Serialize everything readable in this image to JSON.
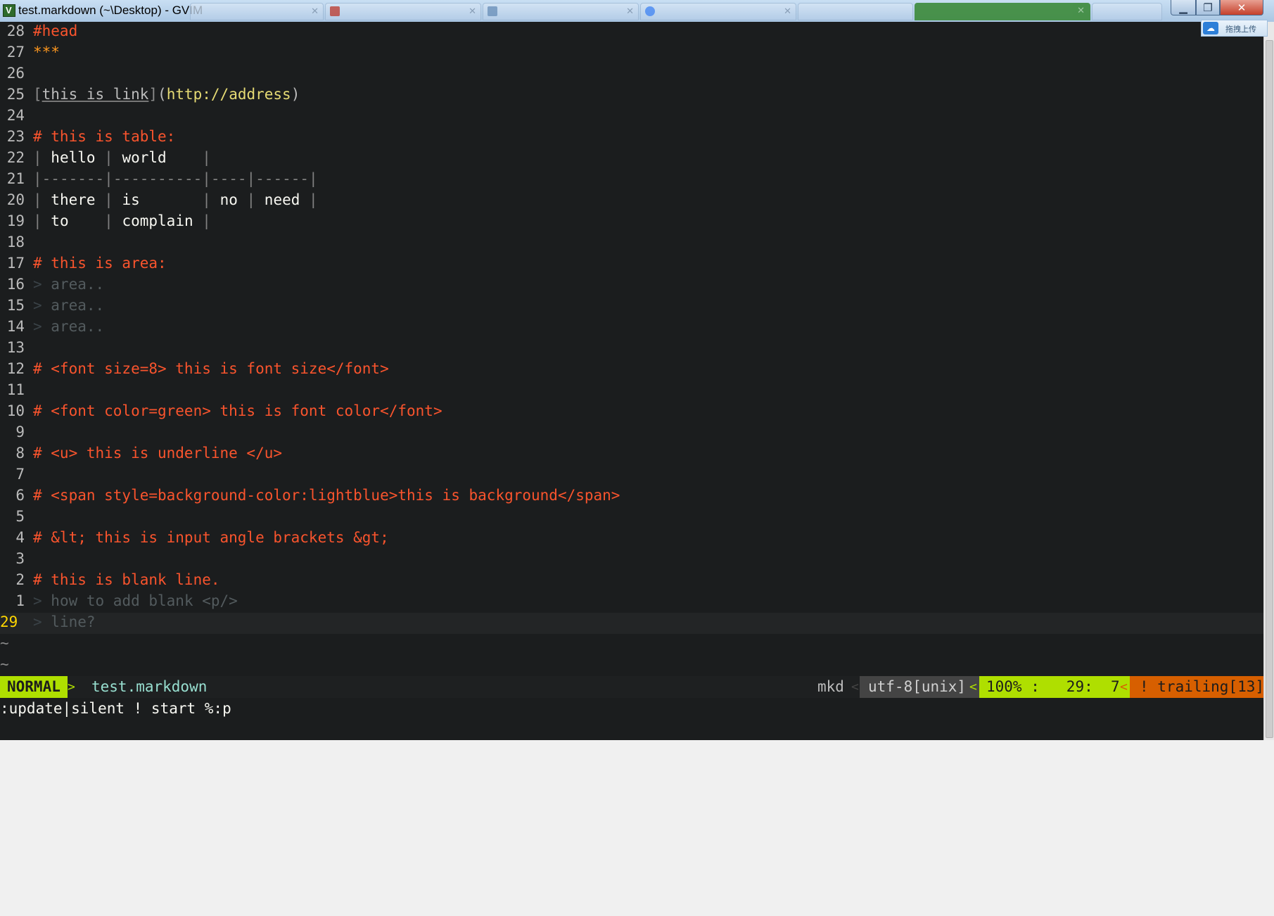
{
  "window": {
    "title": "test.markdown (~\\Desktop) - GVIM",
    "controls": {
      "minimize": "▁",
      "maximize": "❐",
      "close": "✕"
    }
  },
  "upload_widget": {
    "label": "拖拽上传"
  },
  "editor": {
    "lines": [
      {
        "nr": "28",
        "text": "#head",
        "kind": "head"
      },
      {
        "nr": "27",
        "text": "***",
        "kind": "hr"
      },
      {
        "nr": "26",
        "text": "",
        "kind": "plain"
      },
      {
        "nr": "25",
        "link_text": "this is link",
        "link_url": "http://address",
        "kind": "link"
      },
      {
        "nr": "24",
        "text": "",
        "kind": "plain"
      },
      {
        "nr": "23",
        "text": "# this is table:",
        "kind": "head"
      },
      {
        "nr": "22",
        "text": "| hello | world    |",
        "kind": "table"
      },
      {
        "nr": "21",
        "text": "|-------|----------|----|------|",
        "kind": "table-sep"
      },
      {
        "nr": "20",
        "text": "| there | is       | no | need |",
        "kind": "table"
      },
      {
        "nr": "19",
        "text": "| to    | complain |",
        "kind": "table"
      },
      {
        "nr": "18",
        "text": "",
        "kind": "plain"
      },
      {
        "nr": "17",
        "text": "# this is area:",
        "kind": "head"
      },
      {
        "nr": "16",
        "text": "area..",
        "kind": "quote"
      },
      {
        "nr": "15",
        "text": "area..",
        "kind": "quote"
      },
      {
        "nr": "14",
        "text": "area..",
        "kind": "quote"
      },
      {
        "nr": "13",
        "text": "",
        "kind": "plain"
      },
      {
        "nr": "12",
        "text": "# <font size=8> this is font size</font>",
        "kind": "head"
      },
      {
        "nr": "11",
        "text": "",
        "kind": "plain"
      },
      {
        "nr": "10",
        "text": "# <font color=green> this is font color</font>",
        "kind": "head"
      },
      {
        "nr": "9",
        "text": "",
        "kind": "plain"
      },
      {
        "nr": "8",
        "text": "# <u> this is underline </u>",
        "kind": "head"
      },
      {
        "nr": "7",
        "text": "",
        "kind": "plain"
      },
      {
        "nr": "6",
        "text": "# <span style=background-color:lightblue>this is background</span>",
        "kind": "head"
      },
      {
        "nr": "5",
        "text": "",
        "kind": "plain"
      },
      {
        "nr": "4",
        "text": "# &lt; this is input angle brackets &gt;",
        "kind": "head"
      },
      {
        "nr": "3",
        "text": "",
        "kind": "plain"
      },
      {
        "nr": "2",
        "text": "# this is blank line.",
        "kind": "head"
      },
      {
        "nr": "1",
        "text": "how to add blank <p/>",
        "kind": "quote"
      },
      {
        "nr": "29",
        "text": "line?",
        "kind": "quote",
        "current": true
      }
    ],
    "tildes": [
      "~",
      "~"
    ],
    "colors": {
      "background": "#1b1d1e",
      "heading": "#f9542d",
      "line_number": "#bcbcbc",
      "current_line_number": "#ffd700",
      "url": "#e6db74"
    }
  },
  "statusline": {
    "mode": "NORMAL",
    "separator": ">",
    "separator_left": "<",
    "filename": "test.markdown",
    "filetype": "mkd",
    "encoding": "utf-8[unix]",
    "percent": "100% :",
    "line": "29:",
    "column": "7",
    "warning": "! trailing[13]",
    "colors": {
      "mode_bg": "#afdf00",
      "warning_bg": "#d75f00"
    }
  },
  "cmdline": {
    "text": ":update|silent ! start %:p"
  }
}
